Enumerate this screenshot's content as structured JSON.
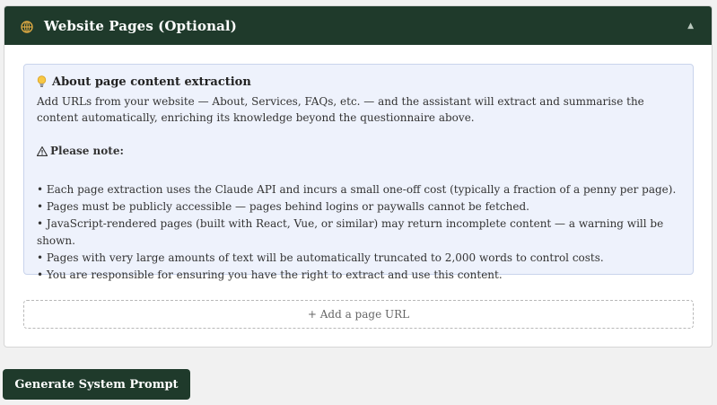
{
  "panel": {
    "title": "Website Pages (Optional)",
    "header_icon": "globe-icon",
    "collapse_icon": "▲",
    "header_color": "#1f3a2b"
  },
  "info": {
    "icon": "lightbulb-icon",
    "title": "About page content extraction",
    "description": "Add URLs from your website — About, Services, FAQs, etc. — and the assistant will extract and summarise the content automatically, enriching its knowledge beyond the questionnaire above.",
    "note_icon": "warning-icon",
    "note_heading": "Please note:",
    "notes": [
      "• Each page extraction uses the Claude API and incurs a small one-off cost (typically a fraction of a penny per page).",
      "• Pages must be publicly accessible — pages behind logins or paywalls cannot be fetched.",
      "• JavaScript-rendered pages (built with React, Vue, or similar) may return incomplete content — a warning will be shown.",
      "• Pages with very large amounts of text will be automatically truncated to 2,000 words to control costs.",
      "• You are responsible for ensuring you have the right to extract and use this content."
    ]
  },
  "add_url": {
    "label": "+ Add a page URL"
  },
  "generate": {
    "label": "Generate System Prompt"
  }
}
